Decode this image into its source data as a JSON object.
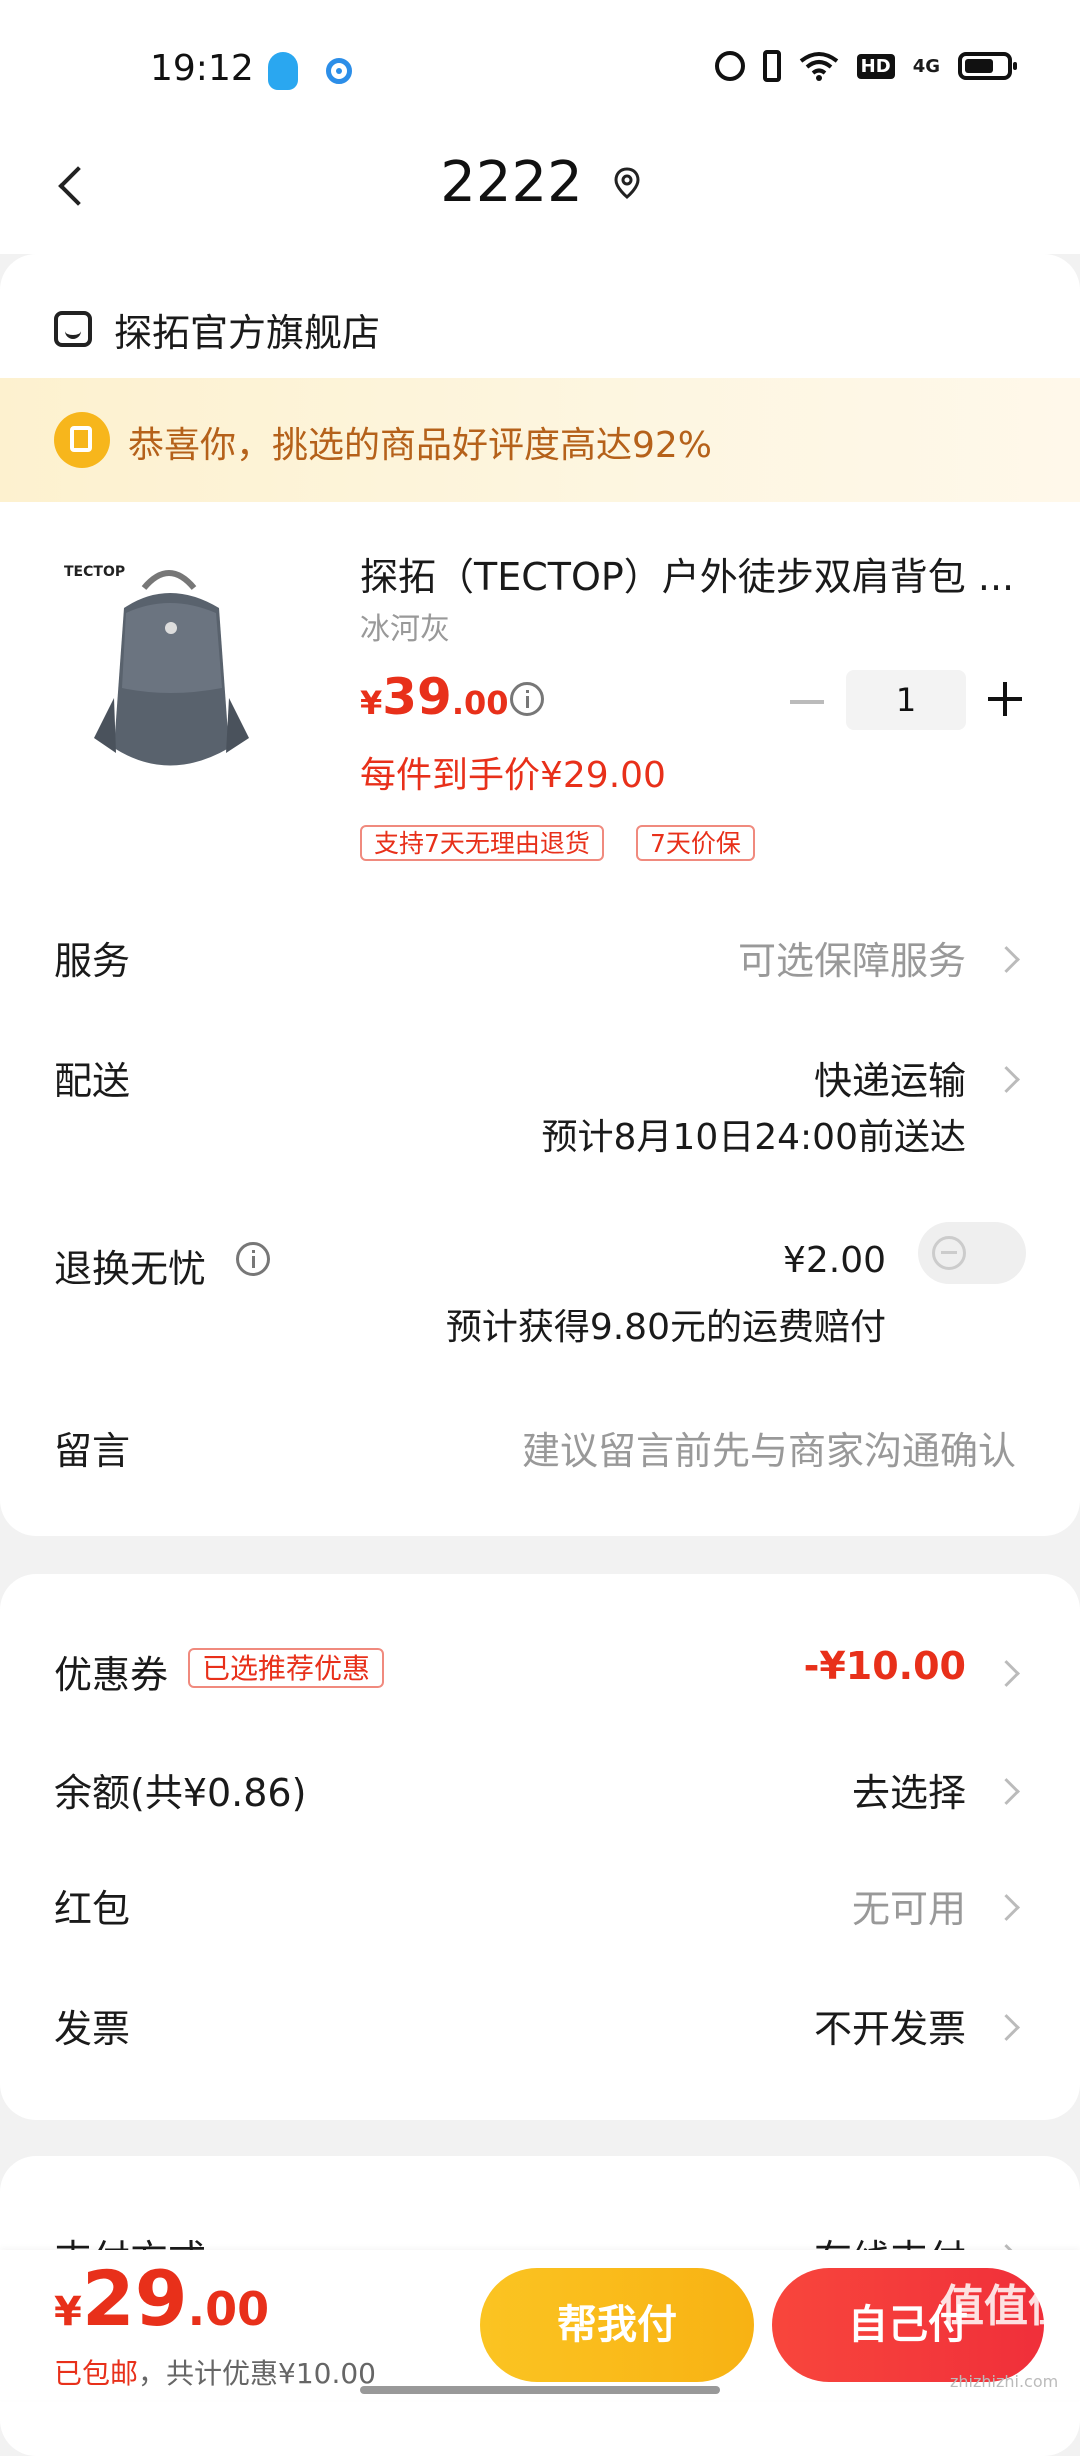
{
  "status_bar": {
    "time": "19:12",
    "icons": [
      "qq-icon",
      "assistant-icon",
      "alarm-icon",
      "vibrate-icon",
      "wifi-icon",
      "hd-icon",
      "signal-4g-icon",
      "battery-icon"
    ],
    "hd_label": "HD",
    "network_label": "4G"
  },
  "header": {
    "title": "2222"
  },
  "shop": {
    "name": "探拓官方旗舰店"
  },
  "banner": {
    "text": "恭喜你，挑选的商品好评度高达92%"
  },
  "product": {
    "name": "探拓（TECTOP）户外徒步双肩背包 ...",
    "variant": "冰河灰",
    "price_symbol": "¥",
    "price_int": "39",
    "price_dec": ".00",
    "final_price_text": "每件到手价¥29.00",
    "quantity": "1",
    "tags": [
      "支持7天无理由退货",
      "7天价保"
    ]
  },
  "order_rows": {
    "service_label": "服务",
    "service_value": "可选保障服务",
    "delivery_label": "配送",
    "delivery_value": "快递运输",
    "delivery_eta": "预计8月10日24:00前送达",
    "return_label": "退换无忧",
    "return_price": "¥2.00",
    "return_note": "预计获得9.80元的运费赔付",
    "message_label": "留言",
    "message_placeholder": "建议留言前先与商家沟通确认"
  },
  "discounts": {
    "coupon_label": "优惠券",
    "coupon_tag": "已选推荐优惠",
    "coupon_value": "-¥10.00",
    "balance_label": "余额(共¥0.86)",
    "balance_value": "去选择",
    "redpacket_label": "红包",
    "redpacket_value": "无可用",
    "invoice_label": "发票",
    "invoice_value": "不开发票"
  },
  "payment": {
    "label": "支付方式",
    "value": "在线支付"
  },
  "bottom_bar": {
    "price_symbol": "¥",
    "price_int": "29",
    "price_dec": ".00",
    "free_shipping": "已包邮",
    "discount_note": "，共计优惠¥10.00",
    "help_pay_label": "帮我付",
    "self_pay_label": "自己付"
  },
  "watermark": {
    "text": "值值值",
    "sub": "zhizhizhi.com"
  },
  "colors": {
    "accent_red": "#e8301a",
    "banner_text": "#b5611a",
    "help_button": "#f8b213",
    "self_button": "#f02f3a"
  }
}
